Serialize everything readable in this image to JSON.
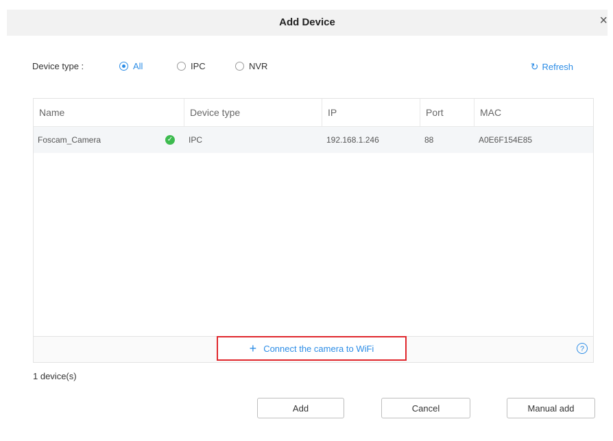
{
  "dialog": {
    "title": "Add Device",
    "close_glyph": "×"
  },
  "filter": {
    "label": "Device type :",
    "options": [
      "All",
      "IPC",
      "NVR"
    ],
    "selected": "All"
  },
  "refresh": {
    "label": "Refresh",
    "icon": "refresh-icon",
    "glyph": "↻"
  },
  "table": {
    "columns": [
      "Name",
      "Device type",
      "IP",
      "Port",
      "MAC"
    ],
    "rows": [
      {
        "name": "Foscam_Camera",
        "device_type": "IPC",
        "ip": "192.168.1.246",
        "port": "88",
        "mac": "A0E6F154E85"
      }
    ],
    "status_glyph": "✓"
  },
  "wifi_link": {
    "label": "Connect the camera to WiFi",
    "plus_glyph": "+"
  },
  "help_glyph": "?",
  "device_count": "1 device(s)",
  "buttons": {
    "add": "Add",
    "cancel": "Cancel",
    "manual_add": "Manual add"
  },
  "colors": {
    "accent": "#2b8ce6",
    "highlight_box": "#e0262b",
    "status_ok": "#3dbb4f"
  }
}
